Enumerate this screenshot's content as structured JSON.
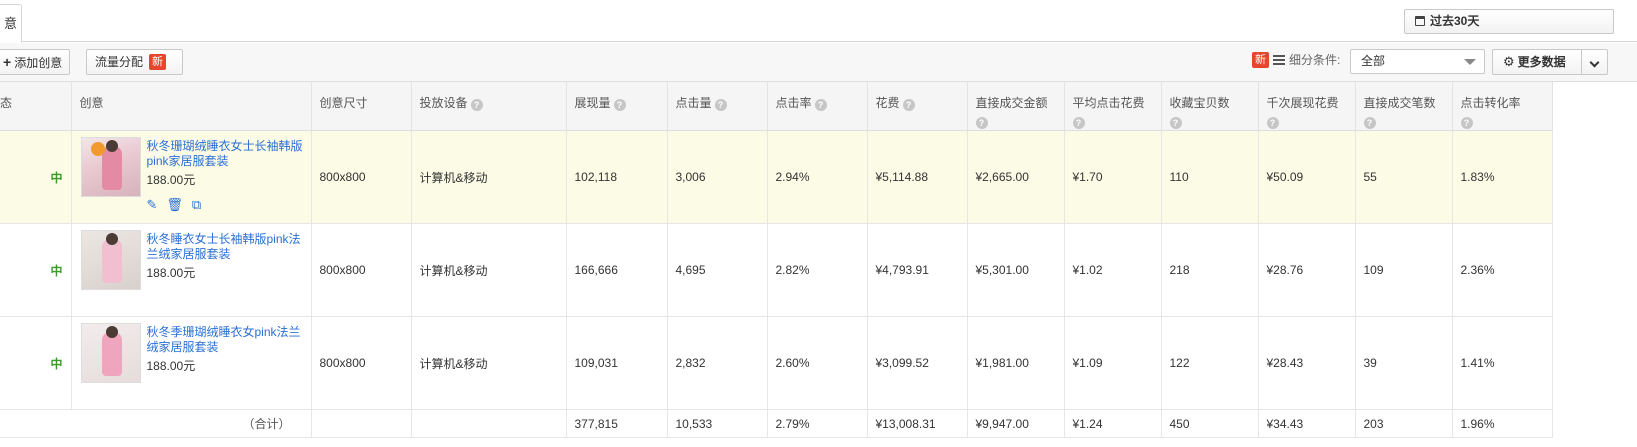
{
  "tabs": {
    "active_label": "意"
  },
  "date_range": {
    "label": "过去30天"
  },
  "toolbar": {
    "add_label": "添加创意",
    "add_icon": "plus-icon",
    "flow_label": "流量分配",
    "flow_badge": "新",
    "filter_badge": "新",
    "filter_label": "细分条件:",
    "filter_value": "全部",
    "more_label": "更多数据"
  },
  "table": {
    "headers": [
      "态",
      "创意",
      "创意尺寸",
      "投放设备",
      "展现量",
      "点击量",
      "点击率",
      "花费",
      "直接成交金额",
      "平均点击花费",
      "收藏宝贝数",
      "千次展现花费",
      "直接成交笔数",
      "点击转化率"
    ],
    "rows": [
      {
        "status": "中",
        "title": "秋冬珊瑚绒睡衣女士长袖韩版pink家居服套装",
        "price": "188.00元",
        "size": "800x800",
        "device": "计算机&移动",
        "impressions": "102,118",
        "clicks": "3,006",
        "ctr": "2.94%",
        "cost": "¥5,114.88",
        "gmv": "¥2,665.00",
        "cpc": "¥1.70",
        "favorites": "110",
        "cpm": "¥50.09",
        "orders": "55",
        "cvr": "1.83%"
      },
      {
        "status": "中",
        "title": "秋冬睡衣女士长袖韩版pink法兰绒家居服套装",
        "price": "188.00元",
        "size": "800x800",
        "device": "计算机&移动",
        "impressions": "166,666",
        "clicks": "4,695",
        "ctr": "2.82%",
        "cost": "¥4,793.91",
        "gmv": "¥5,301.00",
        "cpc": "¥1.02",
        "favorites": "218",
        "cpm": "¥28.76",
        "orders": "109",
        "cvr": "2.36%"
      },
      {
        "status": "中",
        "title": "秋冬季珊瑚绒睡衣女pink法兰绒家居服套装",
        "price": "188.00元",
        "size": "800x800",
        "device": "计算机&移动",
        "impressions": "109,031",
        "clicks": "2,832",
        "ctr": "2.60%",
        "cost": "¥3,099.52",
        "gmv": "¥1,981.00",
        "cpc": "¥1.09",
        "favorites": "122",
        "cpm": "¥28.43",
        "orders": "39",
        "cvr": "1.41%"
      }
    ],
    "total": {
      "label": "（合计）",
      "impressions": "377,815",
      "clicks": "10,533",
      "ctr": "2.79%",
      "cost": "¥13,008.31",
      "gmv": "¥9,947.00",
      "cpc": "¥1.24",
      "favorites": "450",
      "cpm": "¥34.43",
      "orders": "203",
      "cvr": "1.96%"
    }
  },
  "colors": {
    "accent_link": "#2a6fd6",
    "status_green": "#3b9a2a",
    "badge_red": "#e8452e",
    "highlight_row": "#fbfbe6"
  }
}
